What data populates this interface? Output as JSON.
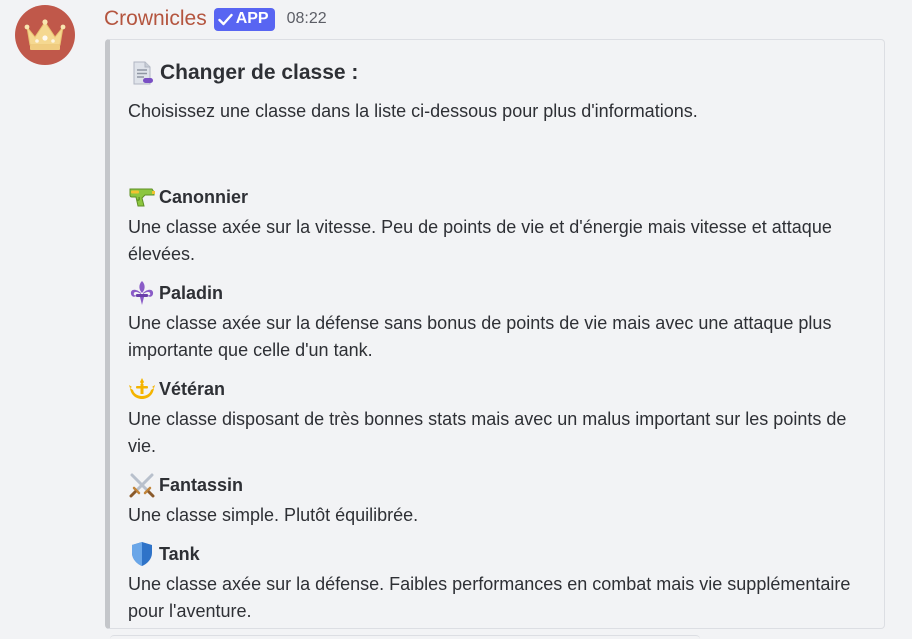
{
  "message": {
    "username": "Crownicles",
    "badge_label": "APP",
    "timestamp": "08:22",
    "avatar_icon": "crown-icon",
    "colors": {
      "username": "#b4553f",
      "avatar_bg": "#c0584a",
      "badge_bg": "#5865f2"
    }
  },
  "embed": {
    "title": "Changer de classe :",
    "title_icon": "document-icon",
    "description": "Choisissez une classe dans la liste ci-dessous pour plus d'informations.",
    "fields": [
      {
        "icon": "water-gun-icon",
        "name": "Canonnier",
        "value": "Une classe axée sur la vitesse. Peu de points de vie et d'énergie mais vitesse et attaque élevées."
      },
      {
        "icon": "fleur-de-lis-icon",
        "name": "Paladin",
        "value": "Une classe axée sur la défense sans bonus de points de vie mais avec une attaque plus importante que celle d'un tank."
      },
      {
        "icon": "trident-emblem-icon",
        "name": "Vétéran",
        "value": "Une classe disposant de très bonnes stats mais avec un malus important sur les points de vie."
      },
      {
        "icon": "crossed-swords-icon",
        "name": "Fantassin",
        "value": "Une classe simple. Plutôt équilibrée."
      },
      {
        "icon": "shield-icon",
        "name": "Tank",
        "value": "Une classe axée sur la défense. Faibles performances en combat mais vie supplémentaire pour l'aventure."
      }
    ]
  }
}
